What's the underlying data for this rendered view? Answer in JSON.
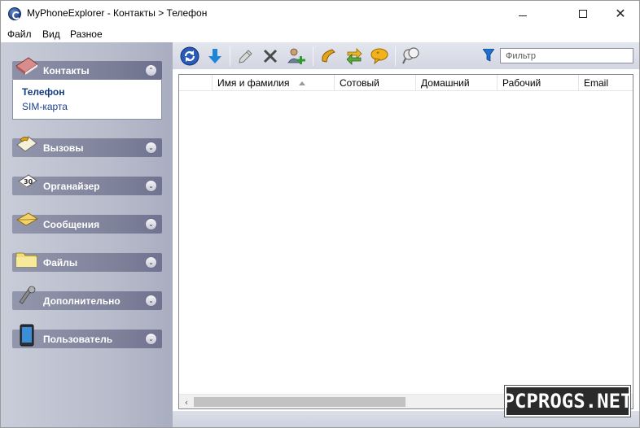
{
  "window": {
    "title": "MyPhoneExplorer -  Контакты > Телефон"
  },
  "menu": [
    "Файл",
    "Вид",
    "Разное"
  ],
  "sidebar": {
    "groups": [
      {
        "label": "Контакты",
        "icon": "contacts-book-icon",
        "expanded": true,
        "items": [
          "Телефон",
          "SIM-карта"
        ]
      },
      {
        "label": "Вызовы",
        "icon": "calls-icon",
        "expanded": false
      },
      {
        "label": "Органайзер",
        "icon": "organizer-calendar-icon",
        "expanded": false
      },
      {
        "label": "Сообщения",
        "icon": "messages-envelope-icon",
        "expanded": false
      },
      {
        "label": "Файлы",
        "icon": "files-folder-icon",
        "expanded": false
      },
      {
        "label": "Дополнительно",
        "icon": "extras-tools-icon",
        "expanded": false
      },
      {
        "label": "Пользователь",
        "icon": "user-phone-icon",
        "expanded": false
      }
    ]
  },
  "toolbar": {
    "buttons": [
      "refresh-icon",
      "download-arrow-icon",
      "edit-pen-icon",
      "delete-x-icon",
      "add-contact-icon",
      "call-phone-icon",
      "sync-arrows-icon",
      "message-bubble-icon",
      "search-binoculars-icon"
    ],
    "filter_placeholder": "Фильтр"
  },
  "table": {
    "columns": [
      "Имя и фамилия",
      "Сотовый",
      "Домашний",
      "Рабочий",
      "Email"
    ],
    "sorted_column": "Имя и фамилия",
    "rows": []
  },
  "watermark": "PCPROGS.NET",
  "colors": {
    "sidebar_header": "#7d8199",
    "link_blue": "#1a3f8a",
    "accent_blue": "#1c3f86"
  }
}
